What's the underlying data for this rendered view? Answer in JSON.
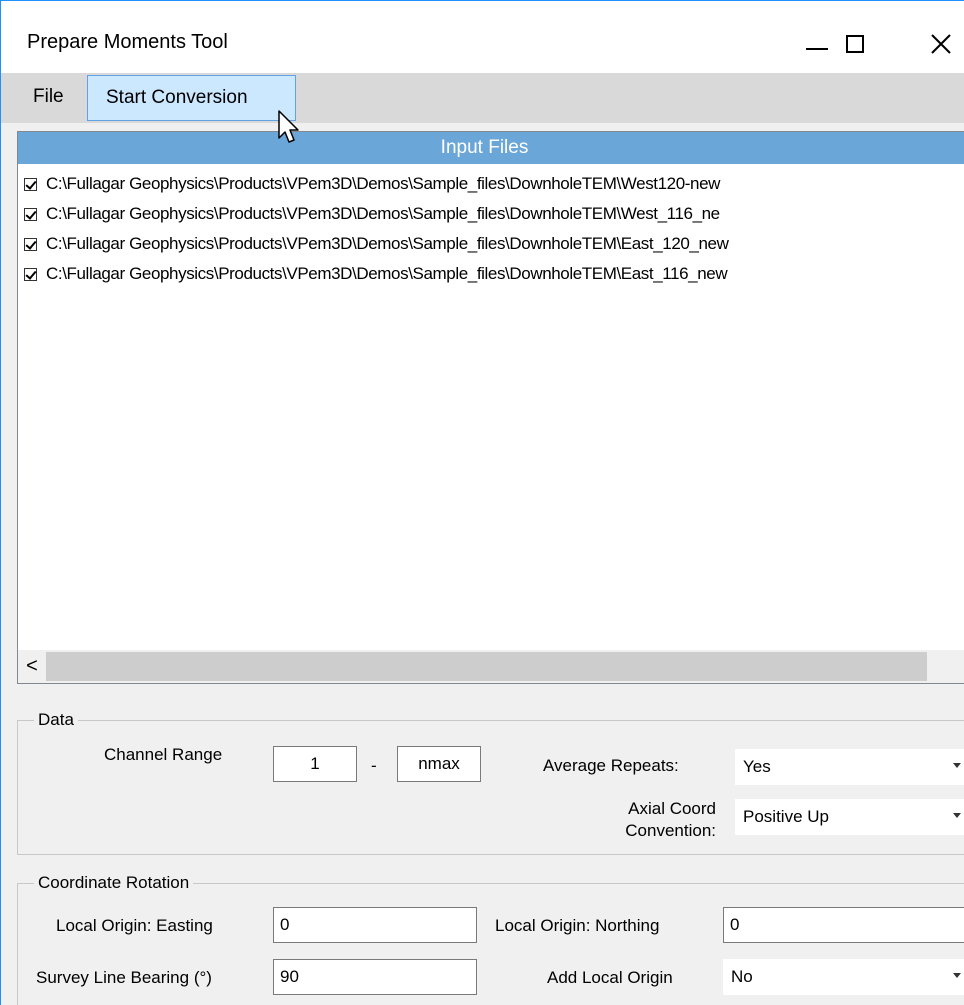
{
  "window": {
    "title": "Prepare Moments Tool"
  },
  "menu": {
    "file": "File",
    "start_conversion": "Start Conversion"
  },
  "file_list": {
    "header": "Input Files",
    "items": [
      {
        "path": "C:\\Fullagar Geophysics\\Products\\VPem3D\\Demos\\Sample_files\\DownholeTEM\\West120-new",
        "checked": true
      },
      {
        "path": "C:\\Fullagar Geophysics\\Products\\VPem3D\\Demos\\Sample_files\\DownholeTEM\\West_116_ne",
        "checked": true
      },
      {
        "path": "C:\\Fullagar Geophysics\\Products\\VPem3D\\Demos\\Sample_files\\DownholeTEM\\East_120_new",
        "checked": true
      },
      {
        "path": "C:\\Fullagar Geophysics\\Products\\VPem3D\\Demos\\Sample_files\\DownholeTEM\\East_116_new",
        "checked": true
      }
    ],
    "scroll_left": "<"
  },
  "data_group": {
    "legend": "Data",
    "channel_range_label": "Channel Range",
    "channel_from": "1",
    "range_separator": "-",
    "channel_to": "nmax",
    "average_repeats_label": "Average Repeats:",
    "average_repeats_value": "Yes",
    "axial_coord_label_line1": "Axial Coord",
    "axial_coord_label_line2": "Convention:",
    "axial_coord_value": "Positive Up"
  },
  "rotation_group": {
    "legend": "Coordinate Rotation",
    "easting_label": "Local Origin: Easting",
    "easting_value": "0",
    "northing_label": "Local Origin:  Northing",
    "northing_value": "0",
    "bearing_label": "Survey Line Bearing (°)",
    "bearing_value": "90",
    "add_origin_label": "Add Local Origin",
    "add_origin_value": "No"
  }
}
